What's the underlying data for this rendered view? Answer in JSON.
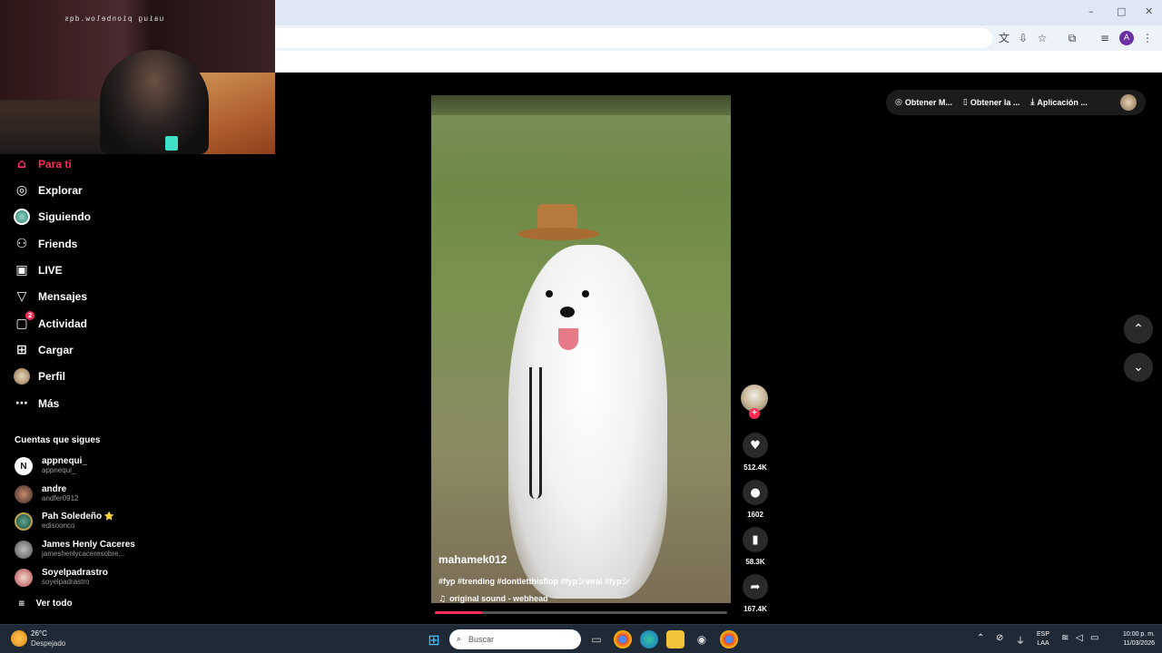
{
  "browser": {
    "window_controls": [
      "–",
      "□",
      "✕"
    ],
    "toolbar_icons": [
      "translate-icon",
      "install-icon",
      "star-icon",
      "extensions-icon",
      "media-icon"
    ],
    "profile_initial": "A"
  },
  "webcam": {
    "watermark": "uaiuɡ pionbelow.dqs"
  },
  "sidebar": {
    "items": [
      {
        "label": "Para ti",
        "icon": "home-icon",
        "active": true
      },
      {
        "label": "Explorar",
        "icon": "compass-icon"
      },
      {
        "label": "Siguiendo",
        "icon": "following-icon"
      },
      {
        "label": "Friends",
        "icon": "friends-icon"
      },
      {
        "label": "LIVE",
        "icon": "live-icon"
      },
      {
        "label": "Mensajes",
        "icon": "messages-icon"
      },
      {
        "label": "Actividad",
        "icon": "activity-icon",
        "badge": "2"
      },
      {
        "label": "Cargar",
        "icon": "upload-icon"
      },
      {
        "label": "Perfil",
        "icon": "profile-icon"
      },
      {
        "label": "Más",
        "icon": "more-icon"
      }
    ],
    "following_title": "Cuentas que sigues",
    "following": [
      {
        "name": "appnequi_",
        "handle": "appnequi_"
      },
      {
        "name": "andre",
        "handle": "andfer0912"
      },
      {
        "name": "Pah Soledeño",
        "handle": "edisoonco",
        "verified_star": "⭐"
      },
      {
        "name": "James Henly Caceres",
        "handle": "jameshenlycaceresobre..."
      },
      {
        "name": "Soyelpadrastro",
        "handle": "soyelpadrastro"
      }
    ],
    "see_all": "Ver todo"
  },
  "video": {
    "username": "mahamek012",
    "description": "#fyp #trending #dontletthisflop #fypシviral #fypシ",
    "sound": "original sound - webhead",
    "progress": 0.16
  },
  "actions": {
    "likes": "512.4K",
    "comments": "1602",
    "saves": "58.3K",
    "shares": "167.4K"
  },
  "topbar": {
    "pills": [
      "Obtener M...",
      "Obtener la ...",
      "Aplicación ..."
    ]
  },
  "taskbar": {
    "temp": "26°C",
    "weather": "Despejado",
    "search_placeholder": "Buscar",
    "lang_line1": "ESP",
    "lang_line2": "LAA",
    "time": "10:00 p. m.",
    "date": "11/03/2026"
  },
  "colors": {
    "accent": "#fe2c55",
    "taskbar": "#1f2a36"
  }
}
